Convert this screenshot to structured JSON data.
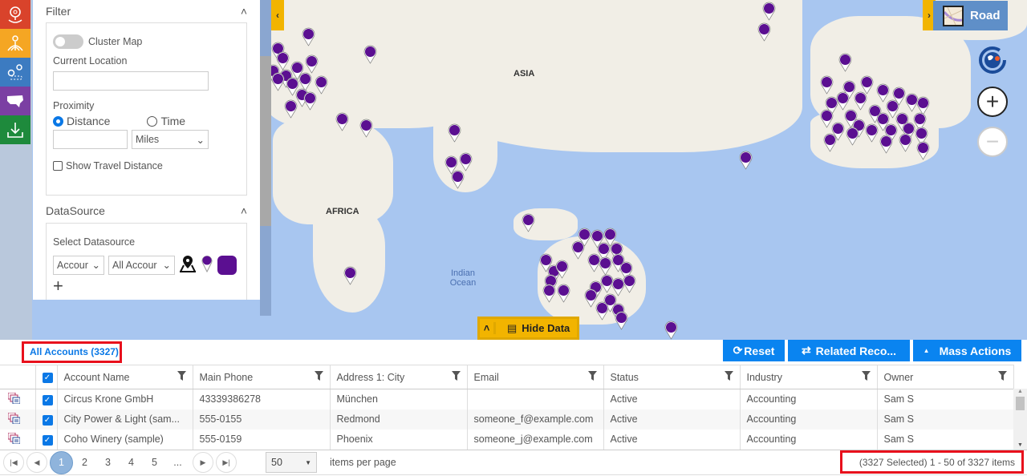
{
  "map": {
    "labels": {
      "asia": "ASIA",
      "africa": "AFRICA",
      "ocean": "Indian Ocean"
    },
    "map_style": "Road",
    "pin_color": "#5b0f91",
    "hide_data_label": "Hide Data"
  },
  "toolbar": {
    "items": [
      {
        "icon": "location-pin-icon",
        "color": "#d9432b"
      },
      {
        "icon": "territory-network-icon",
        "color": "#f5a623"
      },
      {
        "icon": "route-icon",
        "color": "#3c7bc1"
      },
      {
        "icon": "us-map-icon",
        "color": "#7b3fa3"
      },
      {
        "icon": "download-icon",
        "color": "#1e8a3c"
      }
    ]
  },
  "filter": {
    "title": "Filter",
    "cluster_map": "Cluster Map",
    "current_location": "Current Location",
    "current_location_value": "",
    "proximity": "Proximity",
    "distance": "Distance",
    "time": "Time",
    "distance_value": "",
    "unit": "Miles",
    "show_travel": "Show Travel Distance"
  },
  "datasource": {
    "title": "DataSource",
    "select_label": "Select Datasource",
    "entity": "Accour",
    "view": "All Accour",
    "color": "#5b0f91"
  },
  "grid": {
    "view_label": "All Accounts (3327)",
    "buttons": {
      "reset": "Reset",
      "related": "Related Reco...",
      "mass": "Mass Actions"
    },
    "columns": [
      "Account Name",
      "Main Phone",
      "Address 1: City",
      "Email",
      "Status",
      "Industry",
      "Owner"
    ],
    "rows": [
      [
        "Circus Krone GmbH",
        "43339386278",
        "München",
        "",
        "Active",
        "Accounting",
        "Sam S"
      ],
      [
        "City Power & Light (sam...",
        "555-0155",
        "Redmond",
        "someone_f@example.com",
        "Active",
        "Accounting",
        "Sam S"
      ],
      [
        "Coho Winery (sample)",
        "555-0159",
        "Phoenix",
        "someone_j@example.com",
        "Active",
        "Accounting",
        "Sam S"
      ]
    ],
    "pager": {
      "pages": [
        "1",
        "2",
        "3",
        "4",
        "5",
        "..."
      ],
      "current_page": "1",
      "page_size": "50",
      "items_per_page": "items per page",
      "summary": "(3327 Selected) 1 - 50 of 3327 items"
    }
  }
}
